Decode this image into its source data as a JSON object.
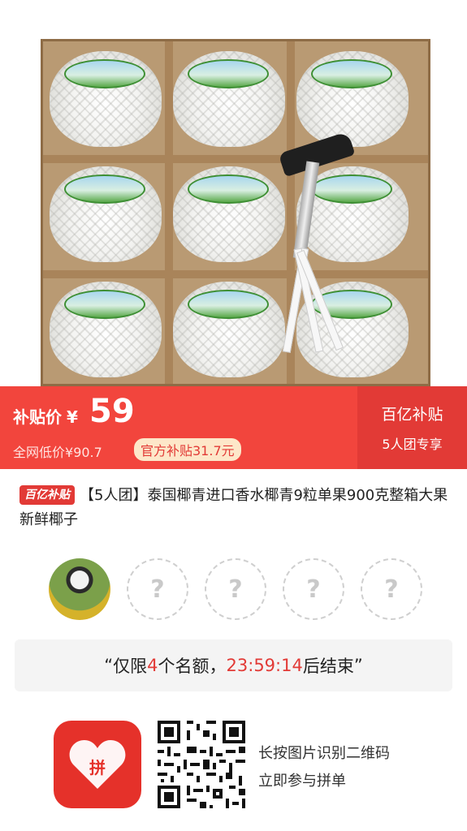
{
  "banner": {
    "subsidy_label": "补贴价",
    "currency": "¥",
    "price": "59",
    "orig_label": "全网低价",
    "orig_price": "¥90.7",
    "official": "官方补贴31.7元",
    "right_title": "百亿补贴",
    "right_sub": "5人团专享"
  },
  "product": {
    "tag": "百亿补贴",
    "title": "【5人团】泰国椰青进口香水椰青9粒单果900克整箱大果新鲜椰子"
  },
  "group": {
    "placeholder": "?",
    "empty_slots": 4
  },
  "countdown": {
    "open_quote": "“",
    "part1": "仅限",
    "count": "4",
    "part2": "个名额，",
    "time": "23:59:14",
    "part3": "后结束",
    "close_quote": "”"
  },
  "footer": {
    "logo_text": "拼",
    "line1": "长按图片识别二维码",
    "line2": "立即参与拼单"
  },
  "colors": {
    "brand_red": "#e23a36",
    "banner_red": "#f2453d",
    "official_bg": "#fde7c9"
  }
}
